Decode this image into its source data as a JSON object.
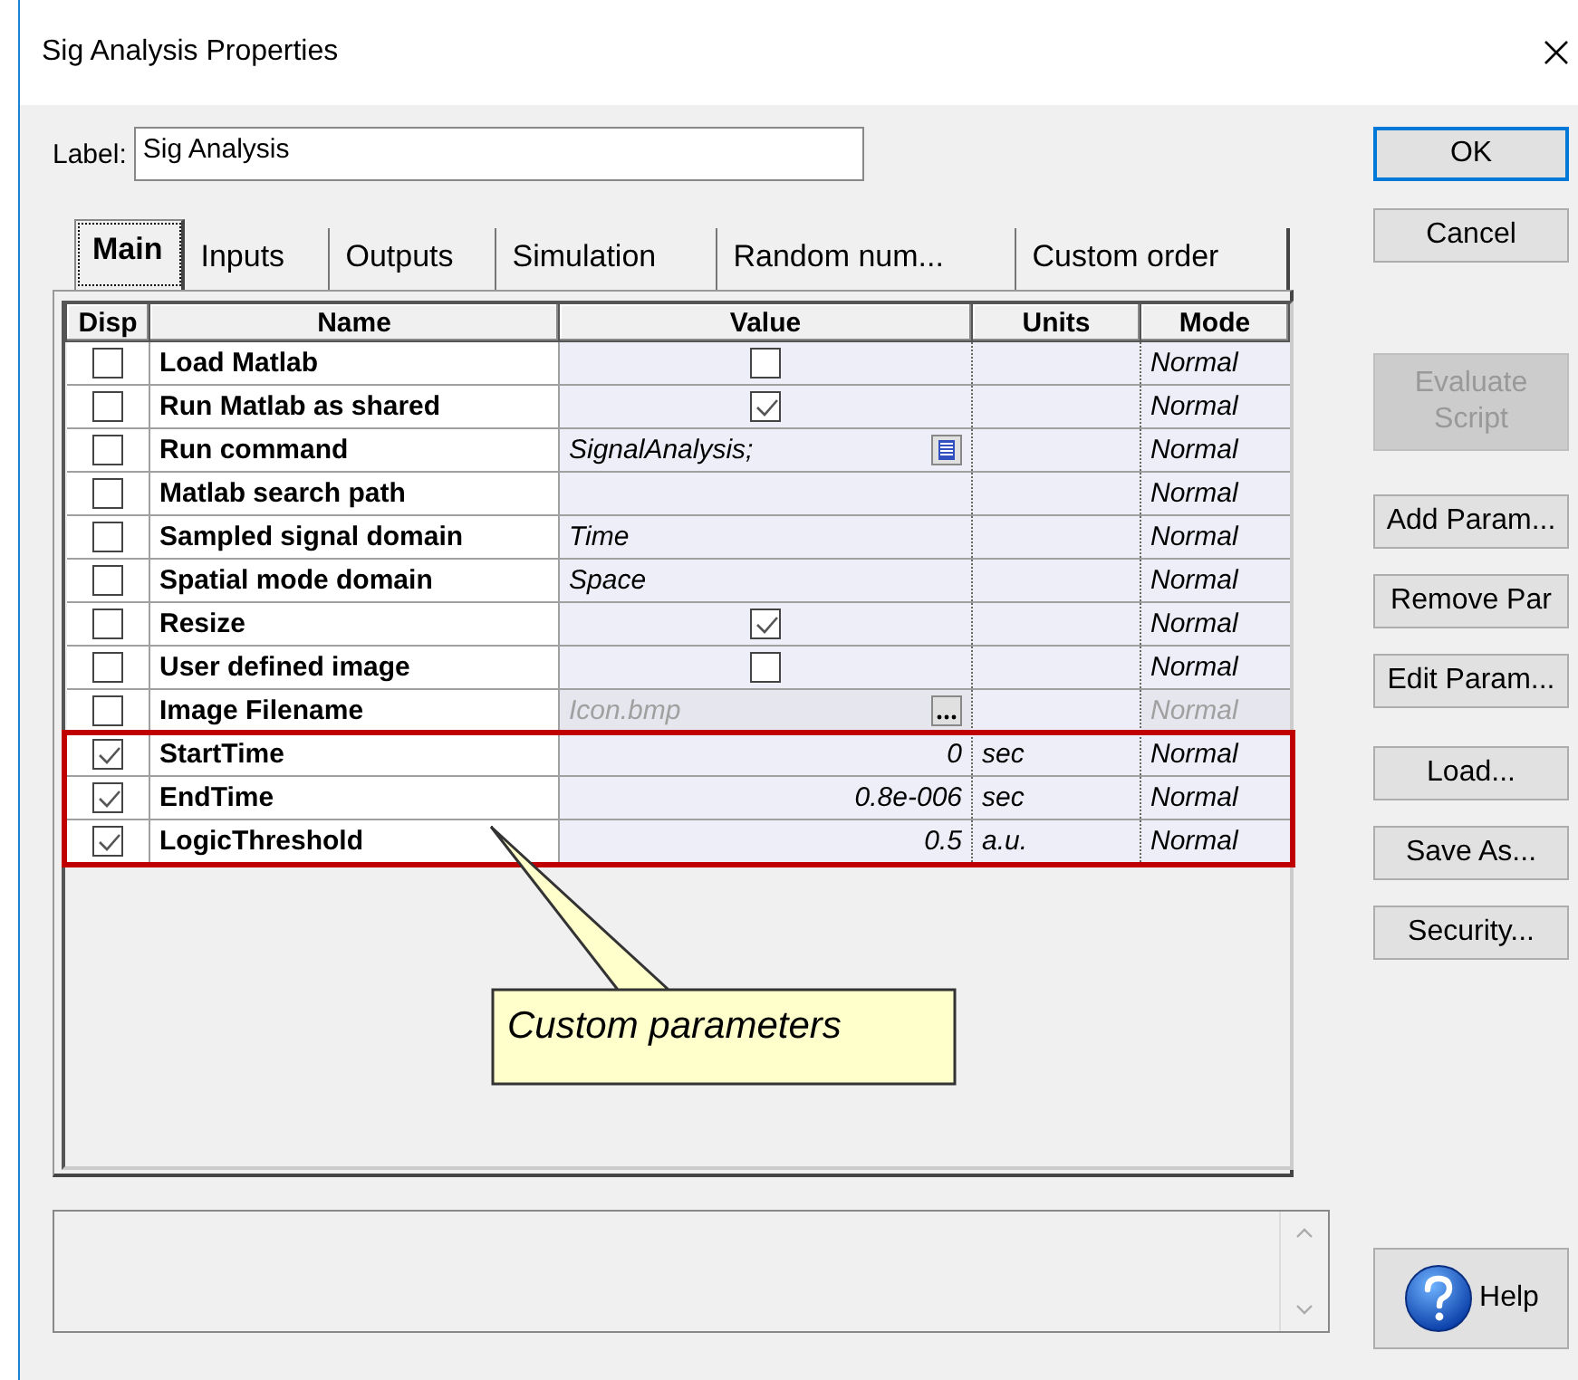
{
  "window": {
    "title": "Sig Analysis Properties"
  },
  "label": {
    "caption": "Label:",
    "value": "Sig Analysis"
  },
  "tabs": [
    {
      "label": "Main",
      "selected": true
    },
    {
      "label": "Inputs",
      "selected": false
    },
    {
      "label": "Outputs",
      "selected": false
    },
    {
      "label": "Simulation",
      "selected": false
    },
    {
      "label": "Random num...",
      "selected": false
    },
    {
      "label": "Custom order",
      "selected": false
    }
  ],
  "grid": {
    "columns": [
      "Disp",
      "Name",
      "Value",
      "Units",
      "Mode"
    ],
    "rows": [
      {
        "disp": false,
        "name": "Load Matlab",
        "value": {
          "kind": "checkbox",
          "checked": false
        },
        "mode": "Normal",
        "disabled": false,
        "highlighted": false
      },
      {
        "disp": false,
        "name": "Run Matlab as shared",
        "value": {
          "kind": "checkbox",
          "checked": true
        },
        "mode": "Normal",
        "disabled": false,
        "highlighted": false
      },
      {
        "disp": false,
        "name": "Run command",
        "value": {
          "kind": "list",
          "text": "SignalAnalysis;"
        },
        "mode": "Normal",
        "disabled": false,
        "highlighted": false
      },
      {
        "disp": false,
        "name": "Matlab search path",
        "value": {
          "kind": "text"
        },
        "mode": "Normal",
        "disabled": false,
        "highlighted": false
      },
      {
        "disp": false,
        "name": "Sampled signal domain",
        "value": {
          "kind": "text",
          "text": "Time"
        },
        "mode": "Normal",
        "disabled": false,
        "highlighted": false
      },
      {
        "disp": false,
        "name": "Spatial mode domain",
        "value": {
          "kind": "text",
          "text": "Space"
        },
        "mode": "Normal",
        "disabled": false,
        "highlighted": false
      },
      {
        "disp": false,
        "name": "Resize",
        "value": {
          "kind": "checkbox",
          "checked": true
        },
        "mode": "Normal",
        "disabled": false,
        "highlighted": false
      },
      {
        "disp": false,
        "name": "User defined image",
        "value": {
          "kind": "checkbox",
          "checked": false
        },
        "mode": "Normal",
        "disabled": false,
        "highlighted": false
      },
      {
        "disp": false,
        "name": "Image Filename",
        "value": {
          "kind": "file",
          "text": "Icon.bmp"
        },
        "mode": "Normal",
        "disabled": true,
        "highlighted": false
      },
      {
        "disp": true,
        "name": "StartTime",
        "value": {
          "kind": "number",
          "text": "0"
        },
        "units": "sec",
        "mode": "Normal",
        "disabled": false,
        "highlighted": true
      },
      {
        "disp": true,
        "name": "EndTime",
        "value": {
          "kind": "number",
          "text": "0.8e-006"
        },
        "units": "sec",
        "mode": "Normal",
        "disabled": false,
        "highlighted": true
      },
      {
        "disp": true,
        "name": "LogicThreshold",
        "value": {
          "kind": "number",
          "text": "0.5"
        },
        "units": "a.u.",
        "mode": "Normal",
        "disabled": false,
        "highlighted": true
      }
    ]
  },
  "callout": {
    "text": "Custom parameters"
  },
  "dialog_buttons": [
    {
      "label": "OK",
      "default": true
    },
    {
      "label": "Cancel",
      "default": false
    }
  ],
  "side_buttons": [
    {
      "label": "Evaluate Script",
      "disabled": true
    },
    {
      "label": "Add Param...",
      "disabled": false
    },
    {
      "label": "Remove Par",
      "disabled": false
    },
    {
      "label": "Edit Param...",
      "disabled": false
    },
    {
      "label": "Load...",
      "disabled": false
    },
    {
      "label": "Save As...",
      "disabled": false
    },
    {
      "label": "Security...",
      "disabled": false
    }
  ],
  "help_button": {
    "label": "Help"
  }
}
